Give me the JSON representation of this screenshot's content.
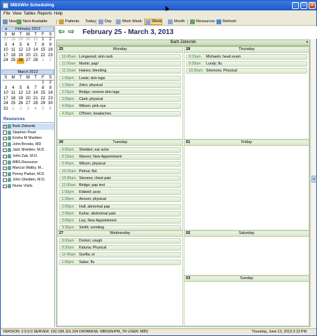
{
  "window": {
    "title": "MBSWin Scheduling"
  },
  "menu": [
    "File",
    "View",
    "Tables",
    "Reports",
    "Help"
  ],
  "toolbar": {
    "new": "New",
    "next_available": "Next Available",
    "patients": "Patients",
    "today": "Today",
    "day": "Day",
    "work_week": "Work Week",
    "week": "Week",
    "month": "Month",
    "resources": "Resources",
    "refresh": "Refresh"
  },
  "mini_cal": {
    "weekday_headers": [
      "S",
      "M",
      "T",
      "W",
      "T",
      "F",
      "S"
    ],
    "feb": {
      "title": "February 2013",
      "days": [
        [
          "27",
          "28",
          "29",
          "30",
          "31",
          "1",
          "2"
        ],
        [
          "3",
          "4",
          "5",
          "6",
          "7",
          "8",
          "9"
        ],
        [
          "10",
          "11",
          "12",
          "13",
          "14",
          "15",
          "16"
        ],
        [
          "17",
          "18",
          "19",
          "20",
          "21",
          "22",
          "23"
        ],
        [
          "24",
          "25",
          "26",
          "27",
          "28",
          "1",
          "2"
        ]
      ]
    },
    "mar": {
      "title": "March 2013",
      "days": [
        [
          "",
          "",
          "",
          "",
          "",
          "1",
          "2"
        ],
        [
          "3",
          "4",
          "5",
          "6",
          "7",
          "8",
          "9"
        ],
        [
          "10",
          "11",
          "12",
          "13",
          "14",
          "15",
          "16"
        ],
        [
          "17",
          "18",
          "19",
          "20",
          "21",
          "22",
          "23"
        ],
        [
          "24",
          "25",
          "26",
          "27",
          "28",
          "29",
          "30"
        ],
        [
          "31",
          "1",
          "2",
          "3",
          "4",
          "5",
          "6"
        ]
      ]
    }
  },
  "resources": {
    "heading": "Resources",
    "items": [
      "Barb Zelesnik",
      "Stephen Pearl",
      "Ericka M Shelden",
      "John Brooks, MD",
      "Jack Shelden, M.D.",
      "John Zak, M.D.",
      "MBS Resource",
      "Marcus Walby, M...",
      "Penny Parker, M.D.",
      "John Shelden, M.D.",
      "Nurse Visits"
    ],
    "checked": [
      true,
      false,
      false,
      false,
      false,
      false,
      false,
      false,
      false,
      false,
      false
    ]
  },
  "date_range": "February 25 - March 3, 2013",
  "resource_bar": "Barb Zelesnik",
  "days": {
    "mon": {
      "num": "25",
      "name": "Monday",
      "appts": [
        [
          "10:45am",
          "Longwood; skin rash"
        ],
        [
          "11:00am",
          "Martin; pap/"
        ],
        [
          "11:15am",
          "Haines; bleeding"
        ],
        [
          "1:00pm",
          "Lewis; skin tags"
        ],
        [
          "1:30pm",
          "Zeko; physical"
        ],
        [
          "2:15pm",
          "Bridge; remove skin tags"
        ],
        [
          "3:00pm",
          "Clark; physical"
        ],
        [
          "4:00pm",
          "Wilson; pink eye"
        ],
        [
          "4:30pm",
          "O'Brien; headaches"
        ]
      ]
    },
    "tue": {
      "num": "26",
      "name": "Tuesday",
      "appts": [
        [
          "9:00am",
          "Shelden; ear ache"
        ],
        [
          "9:15am",
          "Warren; New Appointment"
        ],
        [
          "9:45am",
          "Wilson; physical"
        ],
        [
          "10:15am",
          "Petrus; flut"
        ],
        [
          "10:30am",
          "Stevens; chest pain"
        ],
        [
          "11:00am",
          "Bridge; pap test"
        ],
        [
          "1:00pm",
          "Kidwell; acne"
        ],
        [
          "1:30pm",
          "Arnson; physical"
        ],
        [
          "2:00pm",
          "Hull; abnormal pap"
        ],
        [
          "2:45pm",
          "Kuhar; abdominal pain"
        ],
        [
          "3:00pm",
          "Lisy; New Appointment"
        ],
        [
          "3:30pm",
          "Smith; vomiting"
        ]
      ]
    },
    "wed": {
      "num": "27",
      "name": "Wednesday",
      "appts": [
        [
          "9:00am",
          "Dorton; cough"
        ],
        [
          "9:30am",
          "Katuna; Physical"
        ],
        [
          "11:45am",
          "Gorilla; er"
        ],
        [
          "1:00pm",
          "Saker; flu"
        ]
      ]
    },
    "thu": {
      "num": "28",
      "name": "Thursday",
      "appts": [
        [
          "9:15am",
          "Michaels; head exam"
        ],
        [
          "9:30am",
          "Lundy; flu"
        ],
        [
          "10:30am",
          "Simmons; Physical"
        ]
      ]
    },
    "fri": {
      "num": "01",
      "name": "Friday",
      "appts": []
    },
    "sat": {
      "num": "02",
      "name": "Saturday",
      "appts": []
    },
    "sun": {
      "num": "03",
      "name": "Sunday",
      "appts": []
    }
  },
  "status": {
    "left": "VERSION: 2.5.0.0 SERVER: 192.168.116.104 DATABASE: MBSWinPM_TR USER: MBS",
    "right": "Thursday, June 13, 2013 3:13 PM"
  }
}
